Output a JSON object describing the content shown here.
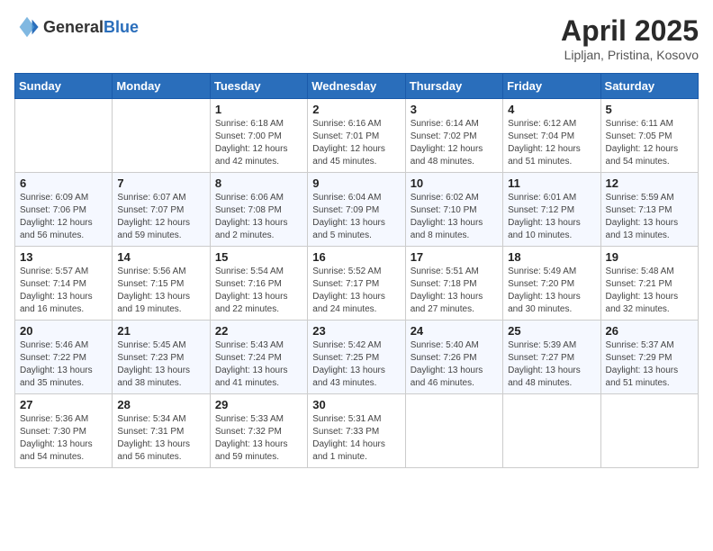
{
  "header": {
    "logo_general": "General",
    "logo_blue": "Blue",
    "month_year": "April 2025",
    "location": "Lipljan, Pristina, Kosovo"
  },
  "days_of_week": [
    "Sunday",
    "Monday",
    "Tuesday",
    "Wednesday",
    "Thursday",
    "Friday",
    "Saturday"
  ],
  "weeks": [
    [
      {
        "day": "",
        "info": ""
      },
      {
        "day": "",
        "info": ""
      },
      {
        "day": "1",
        "info": "Sunrise: 6:18 AM\nSunset: 7:00 PM\nDaylight: 12 hours\nand 42 minutes."
      },
      {
        "day": "2",
        "info": "Sunrise: 6:16 AM\nSunset: 7:01 PM\nDaylight: 12 hours\nand 45 minutes."
      },
      {
        "day": "3",
        "info": "Sunrise: 6:14 AM\nSunset: 7:02 PM\nDaylight: 12 hours\nand 48 minutes."
      },
      {
        "day": "4",
        "info": "Sunrise: 6:12 AM\nSunset: 7:04 PM\nDaylight: 12 hours\nand 51 minutes."
      },
      {
        "day": "5",
        "info": "Sunrise: 6:11 AM\nSunset: 7:05 PM\nDaylight: 12 hours\nand 54 minutes."
      }
    ],
    [
      {
        "day": "6",
        "info": "Sunrise: 6:09 AM\nSunset: 7:06 PM\nDaylight: 12 hours\nand 56 minutes."
      },
      {
        "day": "7",
        "info": "Sunrise: 6:07 AM\nSunset: 7:07 PM\nDaylight: 12 hours\nand 59 minutes."
      },
      {
        "day": "8",
        "info": "Sunrise: 6:06 AM\nSunset: 7:08 PM\nDaylight: 13 hours\nand 2 minutes."
      },
      {
        "day": "9",
        "info": "Sunrise: 6:04 AM\nSunset: 7:09 PM\nDaylight: 13 hours\nand 5 minutes."
      },
      {
        "day": "10",
        "info": "Sunrise: 6:02 AM\nSunset: 7:10 PM\nDaylight: 13 hours\nand 8 minutes."
      },
      {
        "day": "11",
        "info": "Sunrise: 6:01 AM\nSunset: 7:12 PM\nDaylight: 13 hours\nand 10 minutes."
      },
      {
        "day": "12",
        "info": "Sunrise: 5:59 AM\nSunset: 7:13 PM\nDaylight: 13 hours\nand 13 minutes."
      }
    ],
    [
      {
        "day": "13",
        "info": "Sunrise: 5:57 AM\nSunset: 7:14 PM\nDaylight: 13 hours\nand 16 minutes."
      },
      {
        "day": "14",
        "info": "Sunrise: 5:56 AM\nSunset: 7:15 PM\nDaylight: 13 hours\nand 19 minutes."
      },
      {
        "day": "15",
        "info": "Sunrise: 5:54 AM\nSunset: 7:16 PM\nDaylight: 13 hours\nand 22 minutes."
      },
      {
        "day": "16",
        "info": "Sunrise: 5:52 AM\nSunset: 7:17 PM\nDaylight: 13 hours\nand 24 minutes."
      },
      {
        "day": "17",
        "info": "Sunrise: 5:51 AM\nSunset: 7:18 PM\nDaylight: 13 hours\nand 27 minutes."
      },
      {
        "day": "18",
        "info": "Sunrise: 5:49 AM\nSunset: 7:20 PM\nDaylight: 13 hours\nand 30 minutes."
      },
      {
        "day": "19",
        "info": "Sunrise: 5:48 AM\nSunset: 7:21 PM\nDaylight: 13 hours\nand 32 minutes."
      }
    ],
    [
      {
        "day": "20",
        "info": "Sunrise: 5:46 AM\nSunset: 7:22 PM\nDaylight: 13 hours\nand 35 minutes."
      },
      {
        "day": "21",
        "info": "Sunrise: 5:45 AM\nSunset: 7:23 PM\nDaylight: 13 hours\nand 38 minutes."
      },
      {
        "day": "22",
        "info": "Sunrise: 5:43 AM\nSunset: 7:24 PM\nDaylight: 13 hours\nand 41 minutes."
      },
      {
        "day": "23",
        "info": "Sunrise: 5:42 AM\nSunset: 7:25 PM\nDaylight: 13 hours\nand 43 minutes."
      },
      {
        "day": "24",
        "info": "Sunrise: 5:40 AM\nSunset: 7:26 PM\nDaylight: 13 hours\nand 46 minutes."
      },
      {
        "day": "25",
        "info": "Sunrise: 5:39 AM\nSunset: 7:27 PM\nDaylight: 13 hours\nand 48 minutes."
      },
      {
        "day": "26",
        "info": "Sunrise: 5:37 AM\nSunset: 7:29 PM\nDaylight: 13 hours\nand 51 minutes."
      }
    ],
    [
      {
        "day": "27",
        "info": "Sunrise: 5:36 AM\nSunset: 7:30 PM\nDaylight: 13 hours\nand 54 minutes."
      },
      {
        "day": "28",
        "info": "Sunrise: 5:34 AM\nSunset: 7:31 PM\nDaylight: 13 hours\nand 56 minutes."
      },
      {
        "day": "29",
        "info": "Sunrise: 5:33 AM\nSunset: 7:32 PM\nDaylight: 13 hours\nand 59 minutes."
      },
      {
        "day": "30",
        "info": "Sunrise: 5:31 AM\nSunset: 7:33 PM\nDaylight: 14 hours\nand 1 minute."
      },
      {
        "day": "",
        "info": ""
      },
      {
        "day": "",
        "info": ""
      },
      {
        "day": "",
        "info": ""
      }
    ]
  ]
}
